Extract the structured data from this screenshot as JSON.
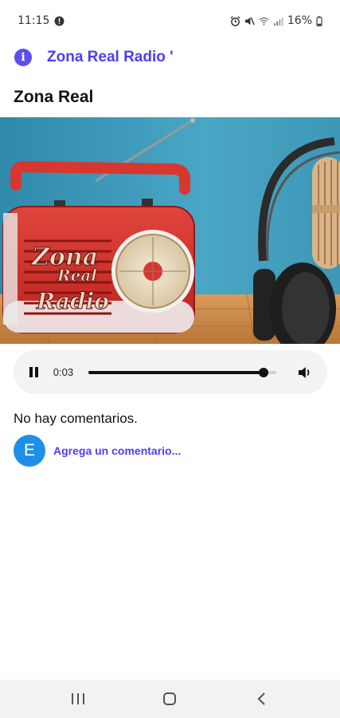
{
  "status_bar": {
    "time": "11:15",
    "battery": "16%"
  },
  "header": {
    "title": "Zona Real Radio '"
  },
  "post": {
    "title": "Zona Real"
  },
  "player": {
    "time": "0:03",
    "progress": 0.93
  },
  "comments": {
    "empty_text": "No hay comentarios.",
    "avatar_letter": "E",
    "add_prompt": "Agrega un comentario..."
  },
  "logo": {
    "line1": "Zona",
    "line2": "Real",
    "line3": "Radio"
  },
  "colors": {
    "accent": "#4b3ff5",
    "avatar": "#1e8fe8",
    "hero_bg": "#3f98b8"
  }
}
